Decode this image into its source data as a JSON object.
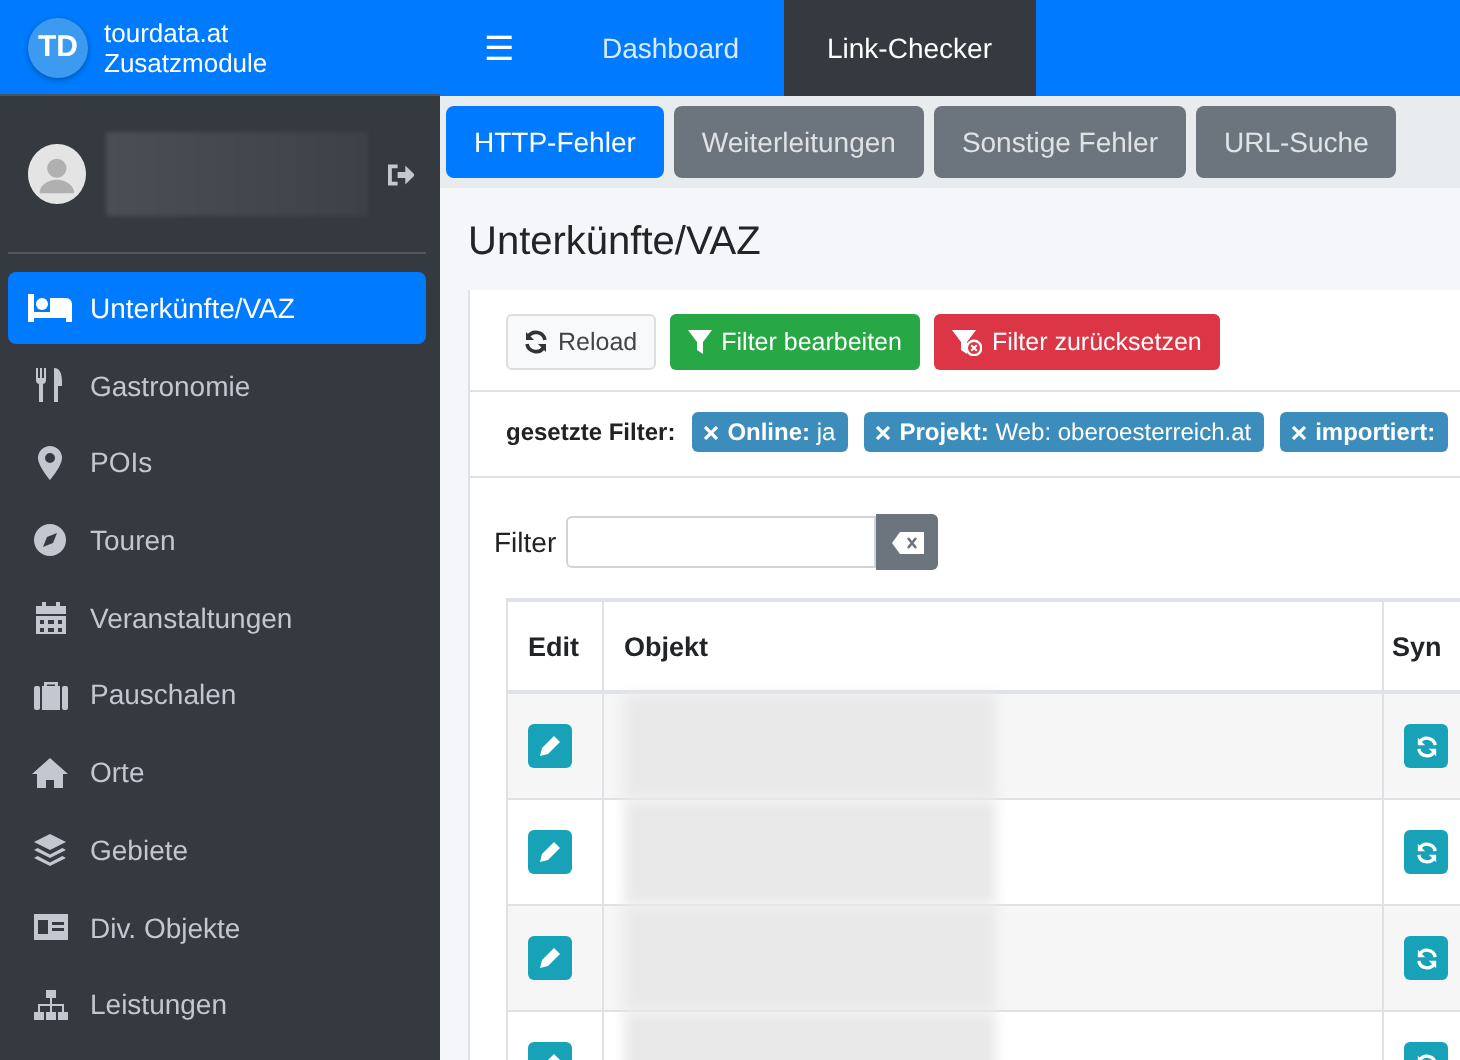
{
  "brand": {
    "logo": "TD",
    "line1": "tourdata.at",
    "line2": "Zusatzmodule"
  },
  "topnav": {
    "menu_glyph": "☰",
    "items": [
      {
        "label": "Dashboard",
        "selected": false
      },
      {
        "label": "Link-Checker",
        "selected": true
      }
    ]
  },
  "user": {
    "redacted": true
  },
  "sidebar": {
    "items": [
      {
        "label": "Unterkünfte/VAZ",
        "selected": true
      },
      {
        "label": "Gastronomie",
        "selected": false
      },
      {
        "label": "POIs",
        "selected": false
      },
      {
        "label": "Touren",
        "selected": false
      },
      {
        "label": "Veranstaltungen",
        "selected": false
      },
      {
        "label": "Pauschalen",
        "selected": false
      },
      {
        "label": "Orte",
        "selected": false
      },
      {
        "label": "Gebiete",
        "selected": false
      },
      {
        "label": "Div. Objekte",
        "selected": false
      },
      {
        "label": "Leistungen",
        "selected": false
      }
    ]
  },
  "tabs": [
    {
      "label": "HTTP-Fehler",
      "selected": true
    },
    {
      "label": "Weiterleitungen",
      "selected": false
    },
    {
      "label": "Sonstige Fehler",
      "selected": false
    },
    {
      "label": "URL-Suche",
      "selected": false
    }
  ],
  "page_title": "Unterkünfte/VAZ",
  "toolbar": [
    {
      "label": "Reload",
      "kind": "reload"
    },
    {
      "label": "Filter bearbeiten",
      "kind": "edit-filter"
    },
    {
      "label": "Filter zurücksetzen",
      "kind": "reset-filter"
    }
  ],
  "active_filters": {
    "label": "gesetzte Filter:",
    "chips": [
      {
        "name": "Online:",
        "value": "ja"
      },
      {
        "name": "Projekt:",
        "value": "Web: oberoesterreich.at"
      },
      {
        "name": "importiert:"
      }
    ]
  },
  "filter": {
    "label": "Filter"
  },
  "table": {
    "columns": [
      "Edit",
      "Objekt",
      "Syn"
    ],
    "rows": [
      {
        "redacted": true
      },
      {
        "redacted": true
      },
      {
        "redacted": true
      },
      {
        "redacted": true
      }
    ]
  }
}
